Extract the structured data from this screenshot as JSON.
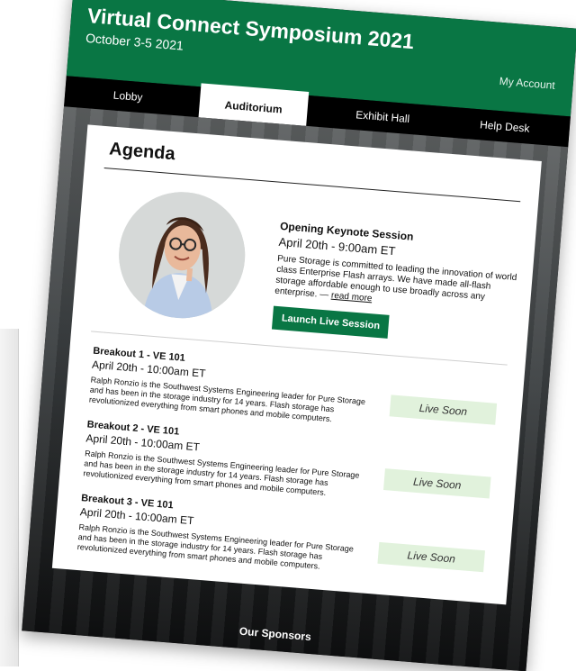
{
  "header": {
    "title": "Virtual Connect Symposium 2021",
    "dates": "October 3-5 2021",
    "account_link": "My Account",
    "brand_color": "#097644"
  },
  "nav": {
    "tabs": [
      {
        "label": "Lobby",
        "active": false
      },
      {
        "label": "Auditorium",
        "active": true
      },
      {
        "label": "Exhibit Hall",
        "active": false
      },
      {
        "label": "Help Desk",
        "active": false
      }
    ]
  },
  "agenda": {
    "title": "Agenda",
    "keynote": {
      "title": "Opening Keynote Session",
      "date": "April 20th - 9:00am ET",
      "description": "Pure Storage is committed to leading the innovation of world class Enterprise Flash arrays. We have made all-flash storage affordable enough to use broadly across any enterprise. —",
      "read_more": "read more",
      "button": "Launch Live Session"
    },
    "breakouts": [
      {
        "title": "Breakout 1 - VE 101",
        "date": "April 20th - 10:00am ET",
        "description": "Ralph Ronzio is the Southwest Systems Engineering leader for Pure Storage and has been in the storage industry for 14 years. Flash storage has revolutionized everything from smart phones and mobile computers.",
        "status": "Live Soon"
      },
      {
        "title": "Breakout 2 - VE 101",
        "date": "April 20th - 10:00am ET",
        "description": "Ralph Ronzio is the Southwest Systems Engineering leader for Pure Storage and has been in the storage industry for 14 years. Flash storage has revolutionized everything from smart phones and mobile computers.",
        "status": "Live Soon"
      },
      {
        "title": "Breakout 3 - VE 101",
        "date": "April 20th - 10:00am ET",
        "description": "Ralph Ronzio is the Southwest Systems Engineering leader for Pure Storage and has been in the storage industry for 14 years. Flash storage has revolutionized everything from smart phones and mobile computers.",
        "status": "Live Soon"
      }
    ]
  },
  "footer": {
    "sponsors": "Our Sponsors"
  }
}
